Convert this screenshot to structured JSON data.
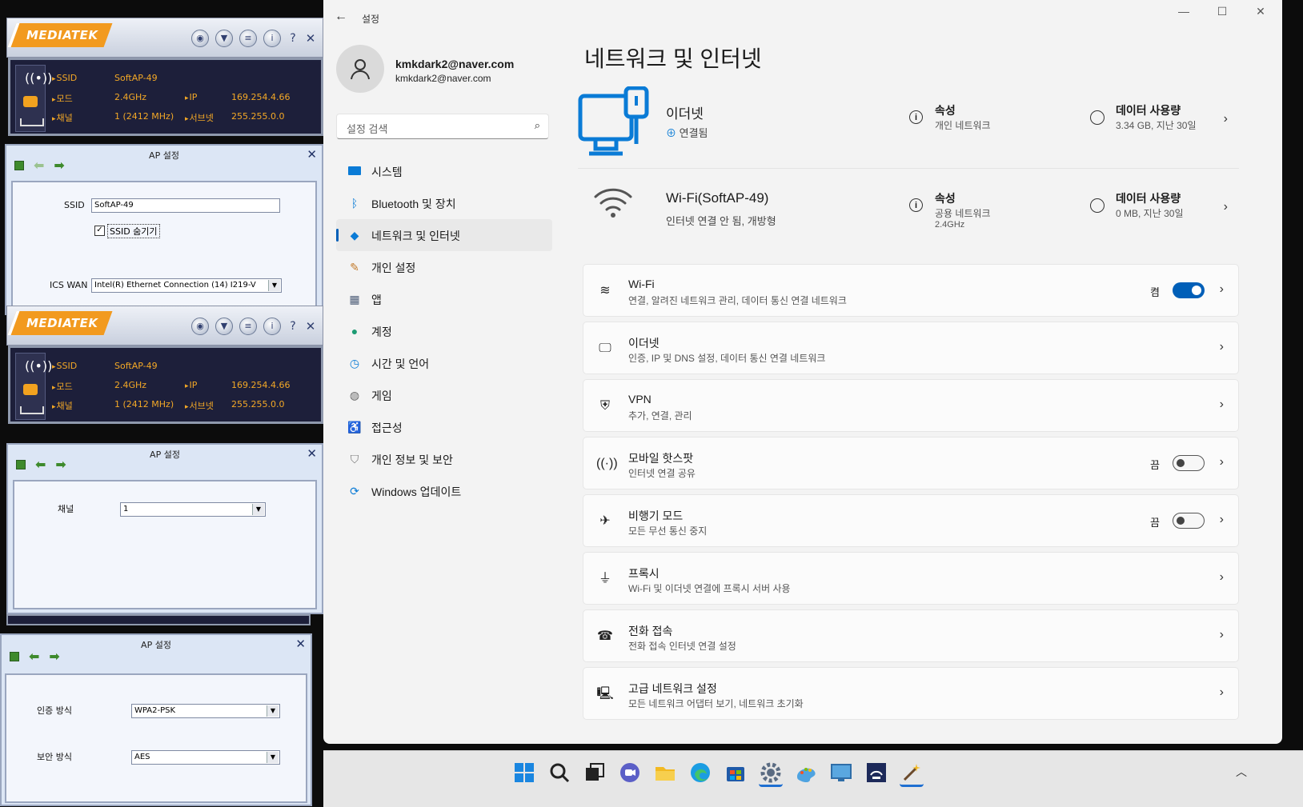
{
  "mtk": {
    "logo": "MEDIATEK",
    "btn_help": "?",
    "btn_close": "✕",
    "status": {
      "ssid_label": "SSID",
      "ssid_value": "SoftAP-49",
      "mode_label": "모드",
      "mode_value": "2.4GHz",
      "channel_label": "채널",
      "channel_value": "1 (2412 MHz)",
      "ip_label": "IP",
      "ip_value": "169.254.4.66",
      "subnet_label": "서브넷",
      "subnet_value": "255.255.0.0"
    },
    "ap1": {
      "title": "AP 설정",
      "ssid_label": "SSID",
      "ssid_value": "SoftAP-49",
      "hide_ssid_label": "SSID 숨기기",
      "ics_label": "ICS WAN",
      "ics_value": "Intel(R) Ethernet Connection (14) I219-V"
    },
    "ap2": {
      "title": "AP 설정",
      "channel_label": "채널",
      "channel_value": "1"
    },
    "ap3": {
      "title": "AP 설정",
      "auth_label": "인증 방식",
      "auth_value": "WPA2-PSK",
      "enc_label": "보안 방식",
      "enc_value": "AES"
    }
  },
  "settings": {
    "window_title": "설정",
    "profile": {
      "name": "kmkdark2@naver.com",
      "email": "kmkdark2@naver.com"
    },
    "search_placeholder": "설정 검색",
    "nav": [
      {
        "label": "시스템",
        "icon": "system-icon"
      },
      {
        "label": "Bluetooth 및 장치",
        "icon": "bluetooth-icon"
      },
      {
        "label": "네트워크 및 인터넷",
        "icon": "network-icon"
      },
      {
        "label": "개인 설정",
        "icon": "brush-icon"
      },
      {
        "label": "앱",
        "icon": "apps-icon"
      },
      {
        "label": "계정",
        "icon": "account-icon"
      },
      {
        "label": "시간 및 언어",
        "icon": "clock-icon"
      },
      {
        "label": "게임",
        "icon": "gamepad-icon"
      },
      {
        "label": "접근성",
        "icon": "accessibility-icon"
      },
      {
        "label": "개인 정보 및 보안",
        "icon": "shield-icon"
      },
      {
        "label": "Windows 업데이트",
        "icon": "update-icon"
      }
    ],
    "page_title": "네트워크 및 인터넷",
    "ethernet": {
      "name": "이더넷",
      "status": "연결됨",
      "prop_title": "속성",
      "prop_sub": "개인 네트워크",
      "data_title": "데이터 사용량",
      "data_sub": "3.34 GB, 지난 30일"
    },
    "wifi_conn": {
      "name": "Wi-Fi(SoftAP-49)",
      "status": "인터넷 연결 안 됨, 개방형",
      "prop_title": "속성",
      "prop_sub": "공용 네트워크",
      "prop_sub2": "2.4GHz",
      "data_title": "데이터 사용량",
      "data_sub": "0 MB, 지난 30일"
    },
    "cards": [
      {
        "title": "Wi-Fi",
        "sub": "연결, 알려진 네트워크 관리, 데이터 통신 연결 네트워크",
        "state": "켬",
        "toggle": "on",
        "icon": "wifi-icon"
      },
      {
        "title": "이더넷",
        "sub": "인증, IP 및 DNS 설정, 데이터 통신 연결 네트워크",
        "icon": "ethernet-icon"
      },
      {
        "title": "VPN",
        "sub": "추가, 연결, 관리",
        "icon": "vpn-shield-icon"
      },
      {
        "title": "모바일 핫스팟",
        "sub": "인터넷 연결 공유",
        "state": "끔",
        "toggle": "off",
        "icon": "hotspot-icon"
      },
      {
        "title": "비행기 모드",
        "sub": "모든 무선 통신 중지",
        "state": "끔",
        "toggle": "off",
        "icon": "airplane-icon"
      },
      {
        "title": "프록시",
        "sub": "Wi-Fi 및 이더넷 연결에 프록시 서버 사용",
        "icon": "proxy-icon"
      },
      {
        "title": "전화 접속",
        "sub": "전화 접속 인터넷 연결 설정",
        "icon": "dialup-icon"
      },
      {
        "title": "고급 네트워크 설정",
        "sub": "모든 네트워크 어댑터 보기, 네트워크 초기화",
        "icon": "advanced-network-icon"
      }
    ]
  },
  "colors": {
    "accent": "#005fb8",
    "mtk_orange": "#f29a1f",
    "mtk_text": "#f3a826"
  }
}
